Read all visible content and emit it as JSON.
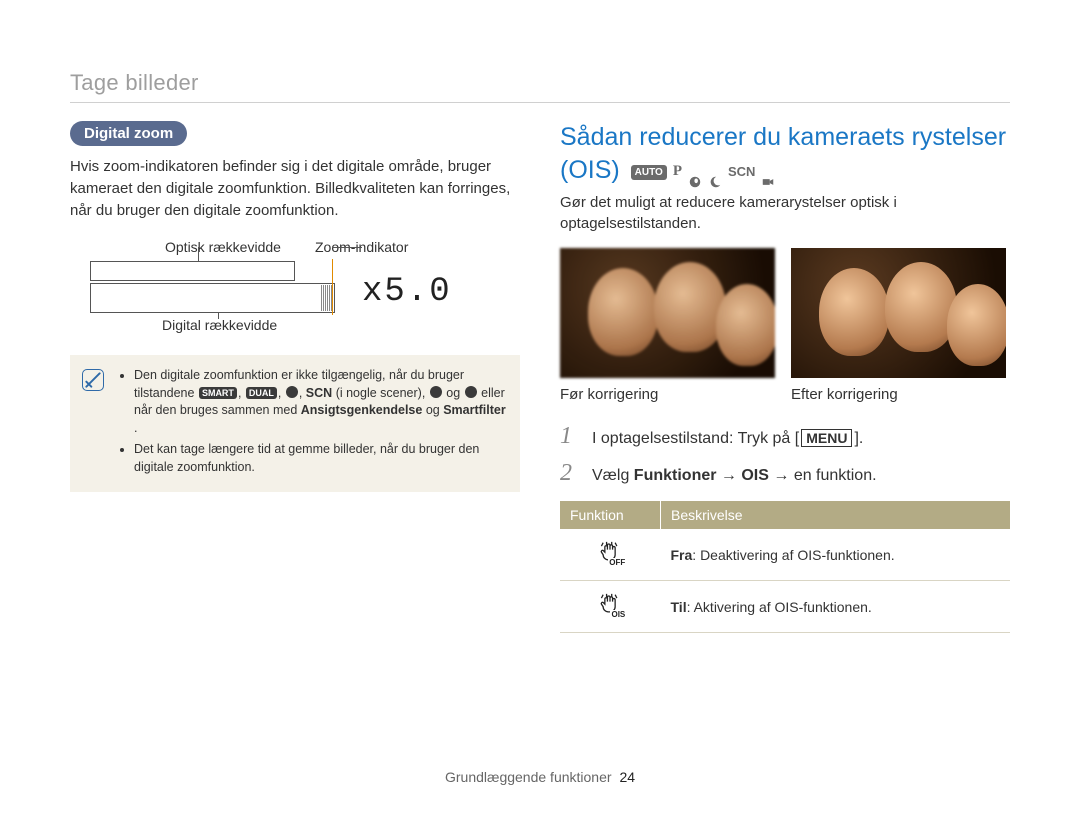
{
  "header": {
    "section_title": "Tage billeder"
  },
  "left": {
    "pill": "Digital zoom",
    "paragraph": "Hvis zoom-indikatoren befinder sig i det digitale område, bruger kameraet den digitale zoomfunktion. Billedkvaliteten kan forringes, når du bruger den digitale zoomfunktion.",
    "diagram": {
      "optical_label": "Optisk rækkevidde",
      "zoom_indicator_label": "Zoom-indikator",
      "digital_label": "Digital rækkevidde",
      "zoom_value": "x5.0"
    },
    "note": {
      "bullet1_pre": "Den digitale zoomfunktion er ikke tilgængelig, når du bruger tilstandene ",
      "bullet1_mode1": "SMART",
      "bullet1_mode2": "DUAL",
      "bullet1_mode3": "SCN",
      "bullet1_mid": " (i nogle scener), ",
      "bullet1_post": " eller når den bruges sammen med ",
      "bullet1_b1": "Ansigtsgenkendelse",
      "bullet1_and": " og ",
      "bullet1_b2": "Smartfilter",
      "bullet1_end": ".",
      "bullet2": "Det kan tage længere tid at gemme billeder, når du bruger den digitale zoomfunktion."
    }
  },
  "right": {
    "title_line1": "Sådan reducerer du kameraets rystelser",
    "title_line2": "(OIS)",
    "modes": {
      "auto": "AUTO",
      "p": "P",
      "scn": "SCN"
    },
    "paragraph": "Gør det muligt at reducere kamerarystelser optisk i optagelsestilstanden.",
    "caption_before": "Før korrigering",
    "caption_after": "Efter korrigering",
    "step1": {
      "num": "1",
      "pre": "I optagelsestilstand: Tryk på [",
      "btn": "MENU",
      "post": "]."
    },
    "step2": {
      "num": "2",
      "pre": "Vælg ",
      "b1": "Funktioner",
      "arrow1": " → ",
      "b2": "OIS",
      "arrow2": " → ",
      "post": "en funktion."
    },
    "table": {
      "col1": "Funktion",
      "col2": "Beskrivelse",
      "row1_sub": "OFF",
      "row1_b": "Fra",
      "row1_txt": ": Deaktivering af OIS-funktionen.",
      "row2_sub": "OIS",
      "row2_b": "Til",
      "row2_txt": ": Aktivering af OIS-funktionen."
    }
  },
  "footer": {
    "text": "Grundlæggende funktioner",
    "page": "24"
  }
}
